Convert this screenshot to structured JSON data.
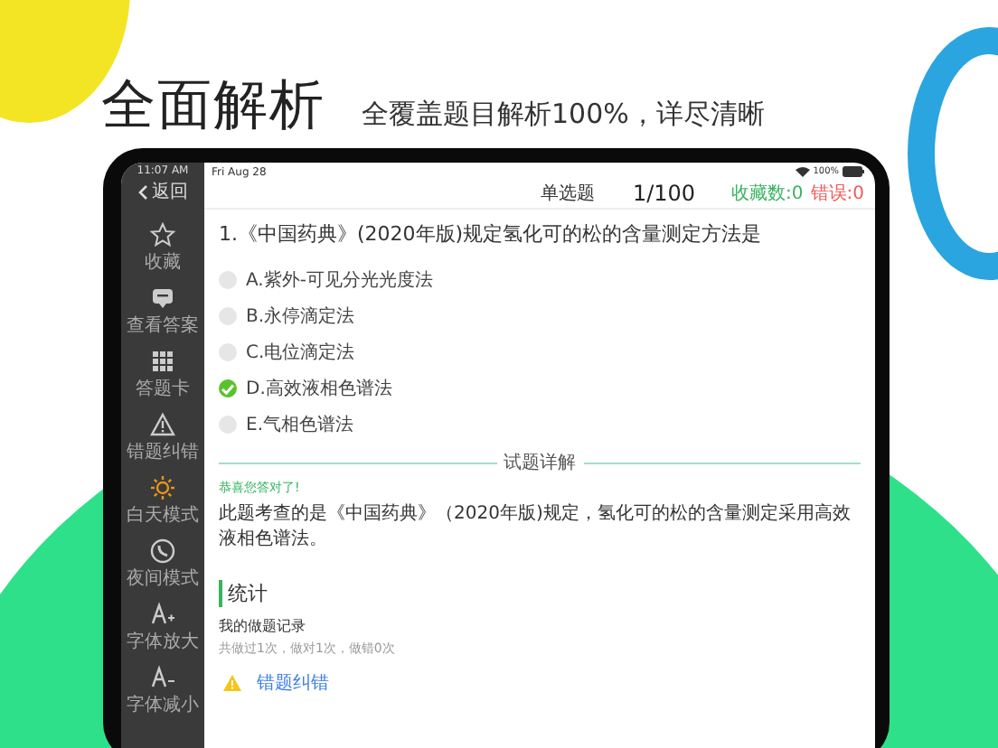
{
  "headline": {
    "title": "全面解析",
    "subtitle": "全覆盖题目解析100%，详尽清晰"
  },
  "status_bar": {
    "time": "11:07 AM",
    "date": "Fri Aug 28",
    "battery": "100%"
  },
  "nav": {
    "back": "返回",
    "title": "单选题",
    "progress": "1/100",
    "favorites": "收藏数:0",
    "errors": "错误:0"
  },
  "sidebar": [
    {
      "kind": "star",
      "label": "收藏"
    },
    {
      "kind": "answer",
      "label": "查看答案"
    },
    {
      "kind": "card",
      "label": "答题卡"
    },
    {
      "kind": "warning",
      "label": "错题纠错"
    },
    {
      "kind": "sun",
      "label": "白天模式"
    },
    {
      "kind": "moon",
      "label": "夜间模式"
    },
    {
      "kind": "font-up",
      "label": "字体放大"
    },
    {
      "kind": "font-down",
      "label": "字体减小"
    }
  ],
  "question": {
    "text": "1.《中国药典》(2020年版)规定氢化可的松的含量测定方法是",
    "options": [
      {
        "label": "A.紫外-可见分光光度法",
        "selected": false
      },
      {
        "label": "B.永停滴定法",
        "selected": false
      },
      {
        "label": "C.电位滴定法",
        "selected": false
      },
      {
        "label": "D.高效液相色谱法",
        "selected": true
      },
      {
        "label": "E.气相色谱法",
        "selected": false
      }
    ]
  },
  "explanation": {
    "heading": "试题详解",
    "result": "恭喜您答对了!",
    "text": "此题考查的是《中国药典》（2020年版)规定，氢化可的松的含量测定采用高效液相色谱法。"
  },
  "stats": {
    "heading": "统计",
    "record_title": "我的做题记录",
    "record": "共做过1次，做对1次，做错0次",
    "report": "错题纠错"
  }
}
